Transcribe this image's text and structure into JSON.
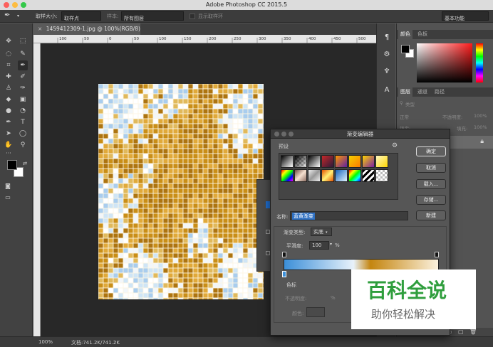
{
  "window": {
    "title": "Adobe Photoshop CC 2015.5"
  },
  "options_bar": {
    "sample_size_label": "取样大小:",
    "sample_size_value": "取样点",
    "sample_label": "样本:",
    "sample_value": "所有图层",
    "show_ring_label": "显示取样环",
    "workspace": "基本功能"
  },
  "document": {
    "tab_title": "1459412309-1.jpg @ 100%(RGB/8) *",
    "ruler_ticks": [
      "100",
      "50",
      "0",
      "50",
      "100",
      "150",
      "200",
      "250",
      "300",
      "350",
      "400",
      "450",
      "500",
      "550"
    ]
  },
  "status_bar": {
    "zoom": "100%",
    "doc_info": "文档:741.2K/741.2K"
  },
  "panels": {
    "color_tabs": [
      "颜色",
      "色板"
    ],
    "layer_tabs": [
      "图层",
      "通道",
      "路径"
    ],
    "kind_label": "类型",
    "blend_mode": "正常",
    "opacity_label": "不透明度:",
    "opacity_value": "100%",
    "lock_label": "锁定:",
    "fill_label": "填充:",
    "fill_value": "100%"
  },
  "gradient_editor": {
    "title": "渐变编辑器",
    "presets_label": "预设",
    "buttons": {
      "ok": "确定",
      "cancel": "取消",
      "load": "载入...",
      "save": "存储...",
      "new": "新建"
    },
    "name_label": "名称:",
    "name_value": "蓝黄渐变",
    "gradient_type_label": "渐变类型:",
    "gradient_type_value": "实底",
    "smoothness_label": "平滑度:",
    "smoothness_value": "100",
    "smoothness_unit": "%",
    "stops_label": "色标",
    "opacity_label": "不透明度:",
    "opacity_unit": "%",
    "color_label": "颜色:"
  },
  "watermark": {
    "title": "百科全说",
    "subtitle": "助你轻松解决"
  },
  "colors": {
    "gradient_start": "#3c8fd8",
    "gradient_mid": "#e8f2fb",
    "gradient_gold": "#c4850f",
    "gradient_end": "#fbf1dd",
    "watermark_green": "#2f9e3d",
    "image_blue": "#cfe5f6",
    "image_gold": "#c98e17"
  }
}
